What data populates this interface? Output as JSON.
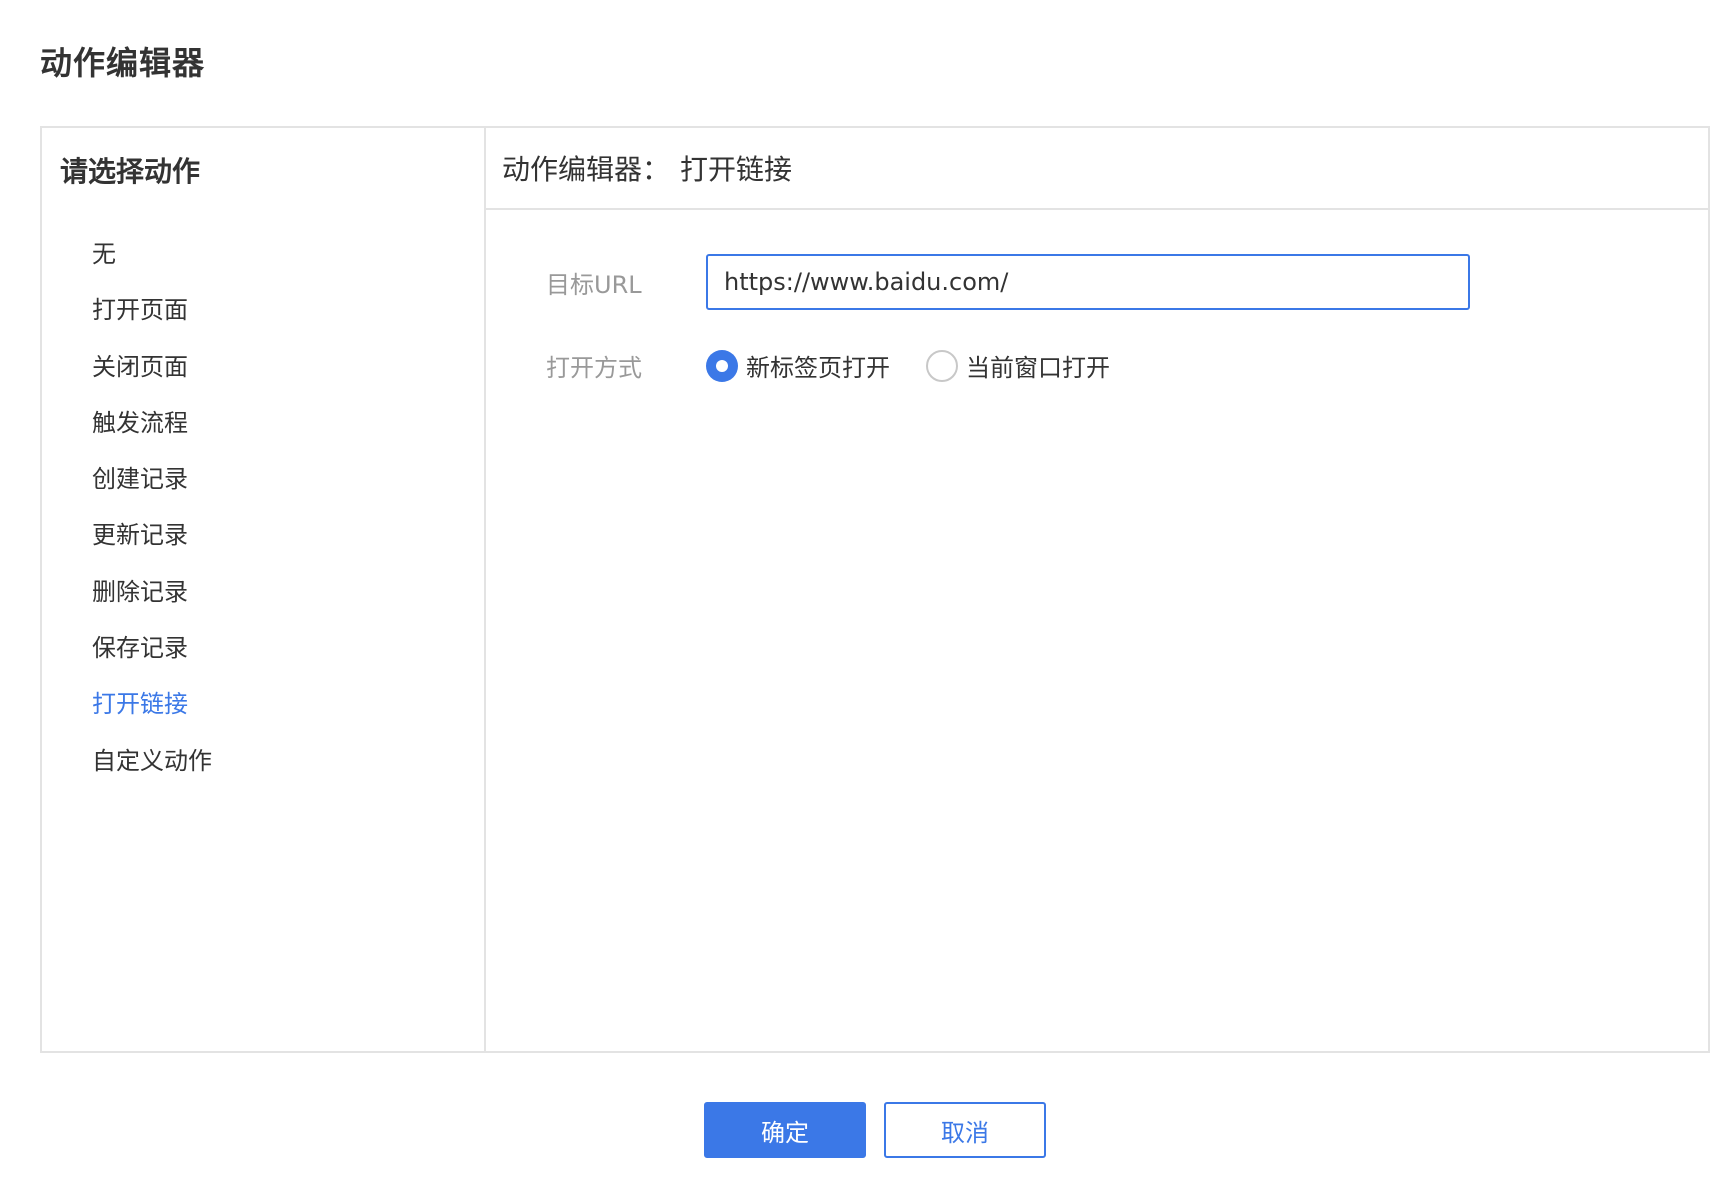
{
  "dialog": {
    "title": "动作编辑器"
  },
  "action_list": {
    "title": "请选择动作",
    "items": [
      {
        "label": "无"
      },
      {
        "label": "打开页面"
      },
      {
        "label": "关闭页面"
      },
      {
        "label": "触发流程"
      },
      {
        "label": "创建记录"
      },
      {
        "label": "更新记录"
      },
      {
        "label": "删除记录"
      },
      {
        "label": "保存记录"
      },
      {
        "label": "打开链接",
        "active": true
      },
      {
        "label": "自定义动作"
      }
    ]
  },
  "editor": {
    "header_prefix": "动作编辑器：",
    "header_action": "打开链接",
    "url_label": "目标URL",
    "url_value": "https://www.baidu.com/",
    "open_mode_label": "打开方式",
    "open_mode_options": [
      {
        "label": "新标签页打开",
        "checked": true
      },
      {
        "label": "当前窗口打开",
        "checked": false
      }
    ]
  },
  "footer": {
    "confirm_label": "确定",
    "cancel_label": "取消"
  },
  "colors": {
    "accent": "#3b78e7",
    "border": "#e3e3e3",
    "label_gray": "#999999",
    "text": "#333333"
  }
}
